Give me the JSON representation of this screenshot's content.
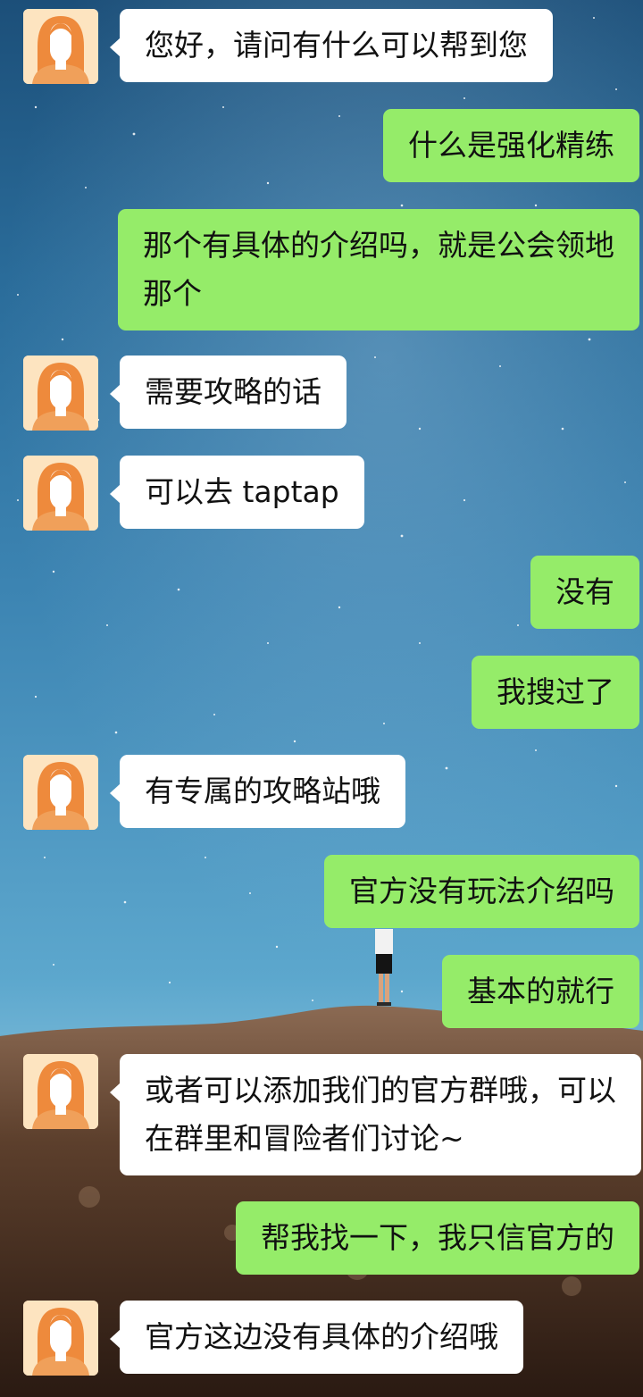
{
  "chat": {
    "agent_avatar": "agent-avatar-icon",
    "colors": {
      "incoming_bubble": "#ffffff",
      "outgoing_bubble": "#95ec69",
      "text": "#111111"
    },
    "messages": [
      {
        "side": "left",
        "text": "您好，请问有什么可以帮到您"
      },
      {
        "side": "right",
        "text": "什么是强化精练"
      },
      {
        "side": "right",
        "text": "那个有具体的介绍吗，就是公会领地那个"
      },
      {
        "side": "left",
        "text": "需要攻略的话"
      },
      {
        "side": "left",
        "text": "可以去 taptap"
      },
      {
        "side": "right",
        "text": "没有"
      },
      {
        "side": "right",
        "text": "我搜过了"
      },
      {
        "side": "left",
        "text": "有专属的攻略站哦"
      },
      {
        "side": "right",
        "text": "官方没有玩法介绍吗"
      },
      {
        "side": "right",
        "text": "基本的就行"
      },
      {
        "side": "left",
        "text": "或者可以添加我们的官方群哦，可以在群里和冒险者们讨论~"
      },
      {
        "side": "right",
        "text": "帮我找一下，我只信官方的"
      },
      {
        "side": "left",
        "text": "官方这边没有具体的介绍哦"
      }
    ]
  }
}
